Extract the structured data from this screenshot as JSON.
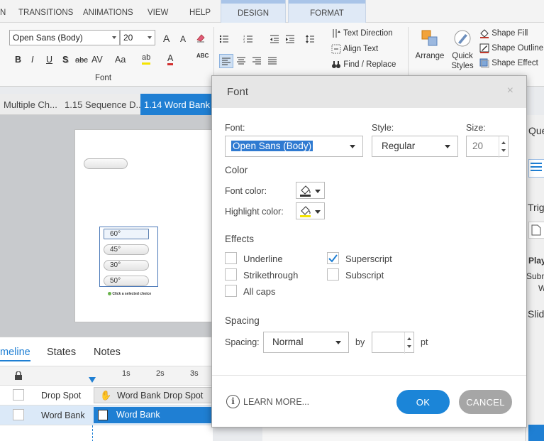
{
  "ribbon_tabs": {
    "partial_first": "N",
    "transitions": "TRANSITIONS",
    "animations": "ANIMATIONS",
    "view": "VIEW",
    "help": "HELP",
    "design": "DESIGN",
    "format": "FORMAT"
  },
  "ribbon": {
    "font_name": "Open Sans (Body)",
    "font_size": "20",
    "grow_font": "A",
    "shrink_font": "A",
    "bold": "B",
    "italic": "I",
    "underline": "U",
    "shadow": "S",
    "strikethrough": "abc",
    "spacing": "AV",
    "change_case": "Aa",
    "highlight": "ab",
    "font_color_glyph": "A",
    "spellcheck": "ABC",
    "font_group_label": "Font",
    "text_direction": "Text Direction",
    "align_text": "Align Text",
    "find_replace": "Find / Replace",
    "arrange": "Arrange",
    "quick_styles_1": "Quick",
    "quick_styles_2": "Styles",
    "shape_fill": "Shape Fill",
    "shape_outline": "Shape Outline",
    "shape_effect": "Shape Effect"
  },
  "slide_tabs": [
    {
      "label": "Multiple Ch..."
    },
    {
      "label": "1.15 Sequence D..."
    },
    {
      "label": "1.14 Word Bank"
    }
  ],
  "slide": {
    "items": [
      "60°",
      "45°",
      "30°",
      "50°"
    ],
    "caption": "Click a selected choice"
  },
  "timeline": {
    "tabs": [
      "meline",
      "States",
      "Notes"
    ],
    "ticks": [
      "1s",
      "2s",
      "3s"
    ],
    "rows": [
      {
        "name": "Drop Spot",
        "bar": "Word Bank Drop Spot"
      },
      {
        "name": "Word Bank",
        "bar": "Word Bank"
      }
    ]
  },
  "right_panel": {
    "ques": "Que",
    "trig": "Trig",
    "play": "Play",
    "subm": "Subm",
    "w": "W",
    "slid": "Slid"
  },
  "dialog": {
    "title": "Font",
    "close": "×",
    "font_label": "Font:",
    "font_value": "Open Sans (Body)",
    "style_label": "Style:",
    "style_value": "Regular",
    "size_label": "Size:",
    "size_value": "20",
    "color_section": "Color",
    "font_color_label": "Font color:",
    "highlight_color_label": "Highlight color:",
    "effects_section": "Effects",
    "effects": {
      "underline": "Underline",
      "strikethrough": "Strikethrough",
      "all_caps": "All caps",
      "superscript": "Superscript",
      "subscript": "Subscript"
    },
    "spacing_section": "Spacing",
    "spacing_label": "Spacing:",
    "spacing_value": "Normal",
    "by_label": "by",
    "pt_label": "pt",
    "learn_more": "LEARN MORE...",
    "info_glyph": "i",
    "ok": "OK",
    "cancel": "CANCEL"
  },
  "colors": {
    "accent": "#1f7fd3",
    "ok_button": "#1b85d8",
    "cancel_button": "#a6a6a6",
    "highlight_yellow": "#f5e400",
    "font_red": "#d32f2f"
  }
}
